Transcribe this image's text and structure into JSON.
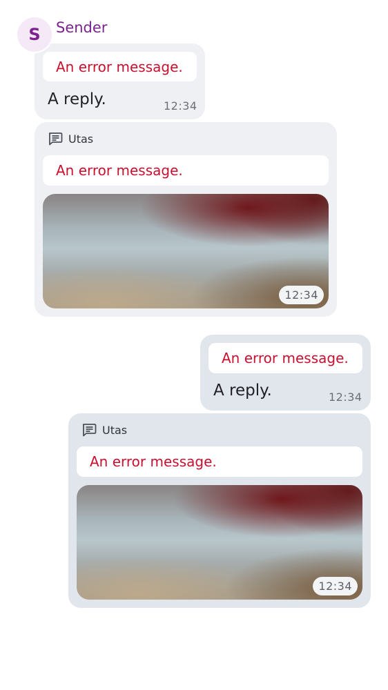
{
  "sender": {
    "initial": "S",
    "name": "Sender"
  },
  "incoming": {
    "reply_message": {
      "error": "An error message.",
      "text": "A reply.",
      "time": "12:34"
    },
    "thread_message": {
      "thread_label": "Utas",
      "error": "An error message.",
      "media_time": "12:34"
    }
  },
  "outgoing": {
    "reply_message": {
      "error": "An error message.",
      "text": "A reply.",
      "time": "12:34"
    },
    "thread_message": {
      "thread_label": "Utas",
      "error": "An error message.",
      "media_time": "12:34"
    }
  },
  "colors": {
    "sender_name": "#7b2290",
    "avatar_bg": "#f5e8f7",
    "error_text": "#c8102e",
    "incoming_bubble": "#eff0f4",
    "outgoing_bubble": "#e1e5ec"
  },
  "icons": {
    "thread": "message-lines-icon"
  }
}
